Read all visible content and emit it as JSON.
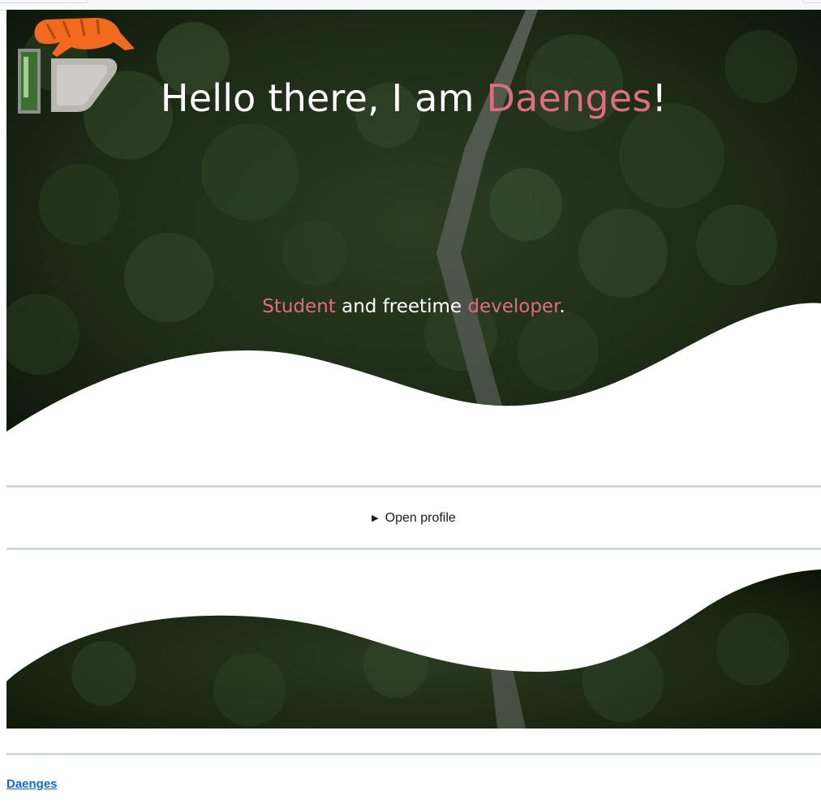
{
  "hero": {
    "title_prefix": "Hello there, I am ",
    "title_name": "Daenges",
    "title_suffix": "!",
    "subtitle_word1": "Student",
    "subtitle_middle": " and freetime ",
    "subtitle_word2": "developer",
    "subtitle_end": "."
  },
  "profile": {
    "summary_marker": "▶",
    "summary_label": "Open profile"
  },
  "footer": {
    "link_label": "Daenges"
  },
  "colors": {
    "accent": "#e06c84",
    "forest_dark": "#1a2612",
    "link": "#1a66c8",
    "rule": "#d3d7dc"
  },
  "icons": {
    "logo": "tiger-on-letter-d-logo"
  }
}
